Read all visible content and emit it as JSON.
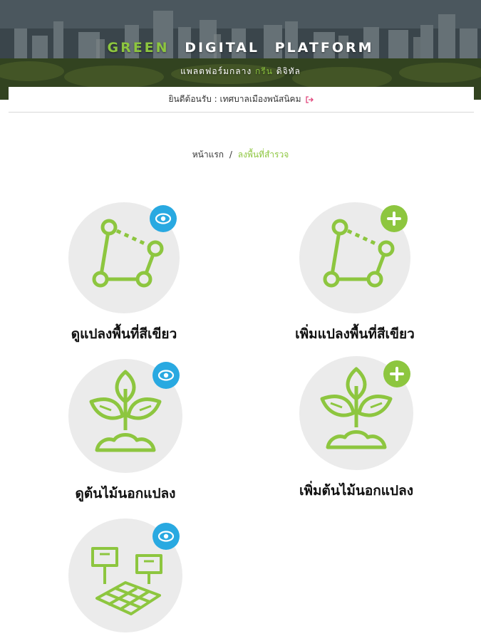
{
  "header": {
    "brand_word1": "GREEN",
    "brand_word2": "DIGITAL",
    "brand_word3": "PLATFORM",
    "subtitle_part1": "แพลตฟอร์มกลาง",
    "subtitle_part2": "กรีน",
    "subtitle_part3": "ดิจิทัล",
    "accent_color": "#8dc63f"
  },
  "welcome": {
    "text": "ยินดีต้อนรับ : เทศบาลเมืองพนัสนิคม",
    "icon": "logout-icon"
  },
  "breadcrumb": {
    "home": "หน้าแรก",
    "separator": "/",
    "current": "ลงพื้นที่สำรวจ"
  },
  "menu": [
    {
      "label": "ดูแปลงพื้นที่สีเขียว",
      "icon": "polygon-plot-icon",
      "badge": "eye-icon"
    },
    {
      "label": "เพิ่มแปลงพื้นที่สีเขียว",
      "icon": "polygon-plot-icon",
      "badge": "plus-icon"
    },
    {
      "label": "ดูต้นไม้นอกแปลง",
      "icon": "plant-sprout-icon",
      "badge": "eye-icon"
    },
    {
      "label": "เพิ่มต้นไม้นอกแปลง",
      "icon": "plant-sprout-icon",
      "badge": "plus-icon"
    },
    {
      "label": "",
      "icon": "grid-survey-icon",
      "badge": "eye-icon"
    }
  ],
  "colors": {
    "view_badge": "#29a9e1",
    "add_badge": "#8dc63f",
    "icon_green": "#8dc63f",
    "circle_bg": "#ebebeb"
  }
}
